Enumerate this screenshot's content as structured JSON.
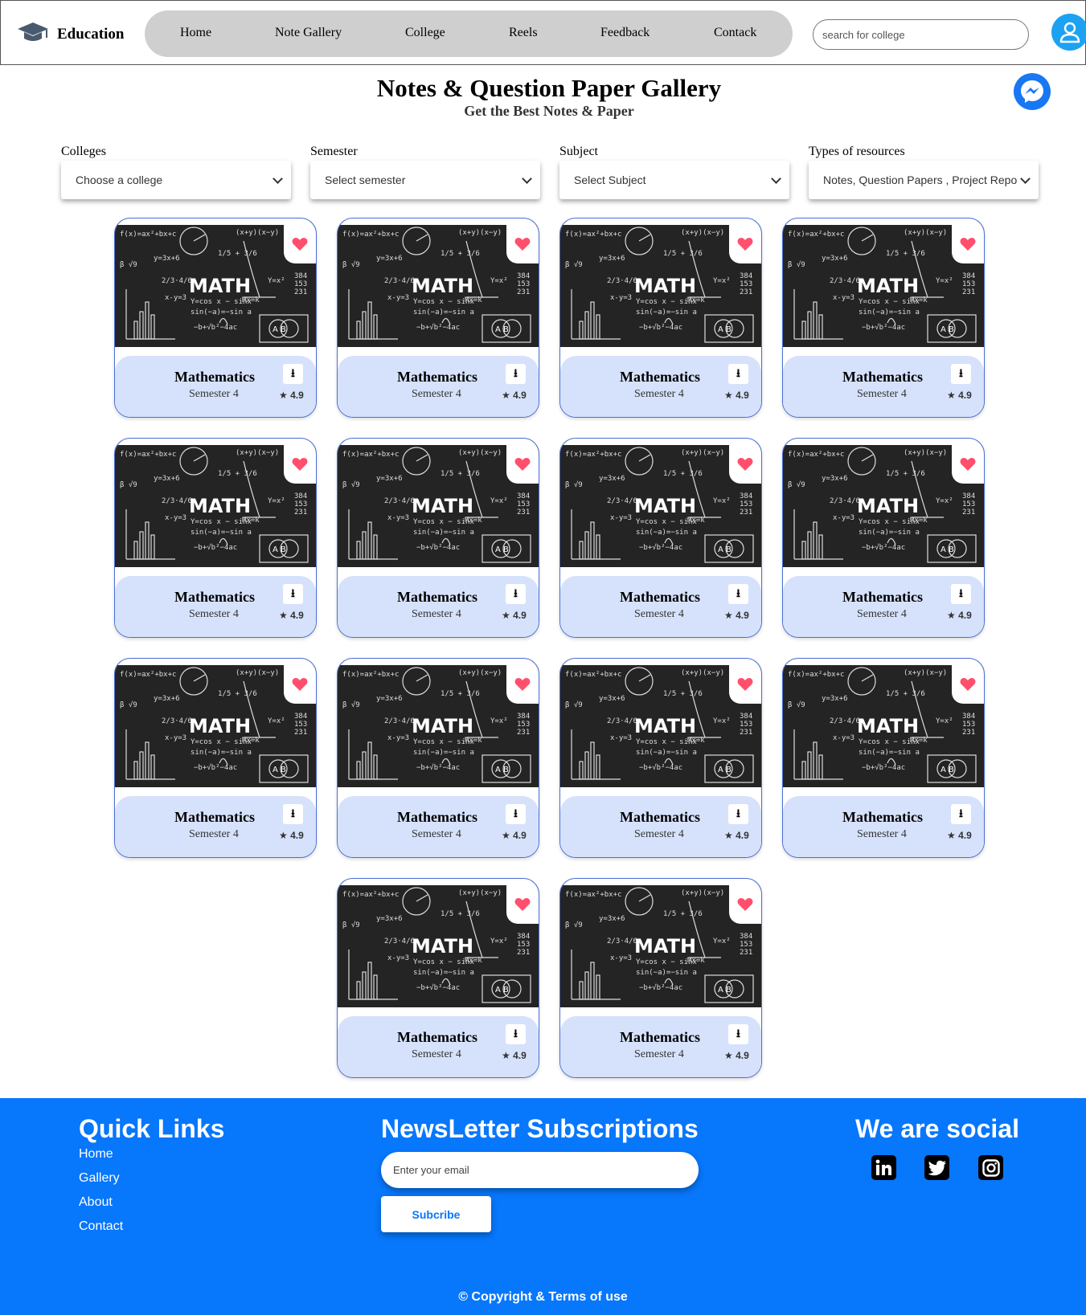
{
  "header": {
    "brand": "Education",
    "nav": [
      "Home",
      "Note Gallery",
      "College",
      "Reels",
      "Feedback",
      "Contack"
    ],
    "search_placeholder": "search for college"
  },
  "page": {
    "title": "Notes & Question Paper Gallery",
    "subtitle": "Get the Best Notes & Paper"
  },
  "filters": [
    {
      "label": "Colleges",
      "value": "Choose a college"
    },
    {
      "label": "Semester",
      "value": "Select semester"
    },
    {
      "label": "Subject",
      "value": "Select Subject"
    },
    {
      "label": "Types of resources",
      "value": "Notes, Question Papers , Project Repor"
    }
  ],
  "card_image_caption": "MATH",
  "cards": [
    {
      "title": "Mathematics",
      "semester": "Semester 4",
      "rating": "4.9"
    },
    {
      "title": "Mathematics",
      "semester": "Semester 4",
      "rating": "4.9"
    },
    {
      "title": "Mathematics",
      "semester": "Semester 4",
      "rating": "4.9"
    },
    {
      "title": "Mathematics",
      "semester": "Semester 4",
      "rating": "4.9"
    },
    {
      "title": "Mathematics",
      "semester": "Semester 4",
      "rating": "4.9"
    },
    {
      "title": "Mathematics",
      "semester": "Semester 4",
      "rating": "4.9"
    },
    {
      "title": "Mathematics",
      "semester": "Semester 4",
      "rating": "4.9"
    },
    {
      "title": "Mathematics",
      "semester": "Semester 4",
      "rating": "4.9"
    },
    {
      "title": "Mathematics",
      "semester": "Semester 4",
      "rating": "4.9"
    },
    {
      "title": "Mathematics",
      "semester": "Semester 4",
      "rating": "4.9"
    },
    {
      "title": "Mathematics",
      "semester": "Semester 4",
      "rating": "4.9"
    },
    {
      "title": "Mathematics",
      "semester": "Semester 4",
      "rating": "4.9"
    },
    {
      "title": "Mathematics",
      "semester": "Semester 4",
      "rating": "4.9"
    },
    {
      "title": "Mathematics",
      "semester": "Semester 4",
      "rating": "4.9"
    }
  ],
  "footer": {
    "quick_links_title": "Quick Links",
    "quick_links": [
      "Home",
      "Gallery",
      "About",
      "Contact"
    ],
    "newsletter_title": "NewsLetter Subscriptions",
    "email_placeholder": "Enter your email",
    "subscribe_label": "Subcribe",
    "social_title": "We are social",
    "social_icons": [
      "linkedin-icon",
      "twitter-icon",
      "instagram-icon"
    ],
    "copyright": "© Copyright & Terms of use"
  },
  "colors": {
    "footer_bg": "#0777fc",
    "nav_bg": "#cfcfcf",
    "card_info_bg": "#d6e2fb",
    "heart": "#ff4f6d"
  }
}
